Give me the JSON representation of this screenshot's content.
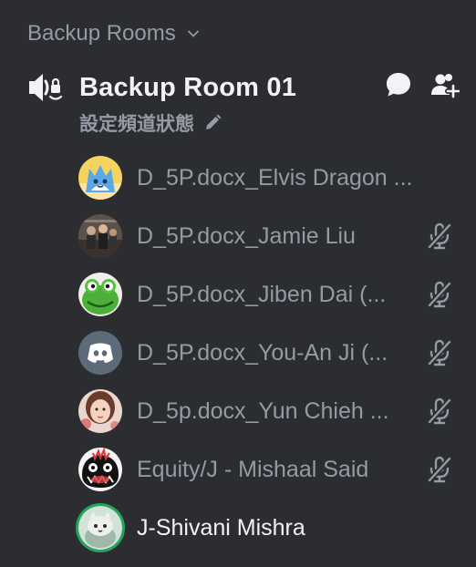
{
  "category": {
    "label": "Backup Rooms"
  },
  "channel": {
    "name": "Backup Room 01",
    "status_placeholder": "設定頻道狀態"
  },
  "members": [
    {
      "name": "D_5P.docx_Elvis Dragon ...",
      "muted": false,
      "avatar": "avatar-blue-fox"
    },
    {
      "name": "D_5P.docx_Jamie Liu",
      "muted": true,
      "avatar": "avatar-photo-band"
    },
    {
      "name": "D_5P.docx_Jiben Dai (...",
      "muted": true,
      "avatar": "avatar-frog"
    },
    {
      "name": "D_5P.docx_You-An Ji (...",
      "muted": true,
      "avatar": "avatar-discord-default"
    },
    {
      "name": "D_5p.docx_Yun Chieh ...",
      "muted": true,
      "avatar": "avatar-photo-portrait"
    },
    {
      "name": "Equity/J - Mishaal Said",
      "muted": true,
      "avatar": "avatar-monster"
    },
    {
      "name": "J-Shivani Mishra",
      "muted": false,
      "avatar": "avatar-cat-speaking",
      "speaking": true
    }
  ],
  "colors": {
    "background": "#2b2d31",
    "muted_text": "#949ba4",
    "bright_text": "#f2f3f5",
    "speaking_ring": "#23a55a",
    "discord_blurple": "#5865f2"
  }
}
